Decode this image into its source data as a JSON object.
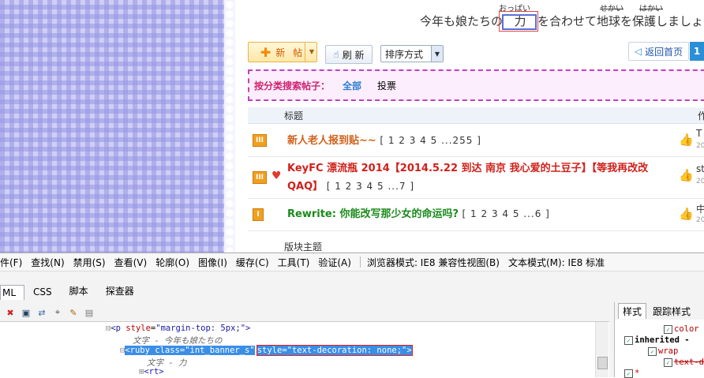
{
  "banner": {
    "text_before": "今年も娘たちの",
    "boxed": "力",
    "text_after": "を合わせて地球を保護しましょ",
    "ruby_chikara": "おっぱい",
    "ruby_chikyuu": "せかい",
    "ruby_hogo": "はかい"
  },
  "toolbar": {
    "new_post": "新 帖",
    "refresh": "刷 新",
    "sort": "排序方式",
    "back_home": "返回首页",
    "page": "1"
  },
  "filter": {
    "label": "按分类搜索帖子：",
    "selected": "全部",
    "other": "投票"
  },
  "table": {
    "col_title": "标题",
    "col_author": "作",
    "rows": [
      {
        "icon": "III",
        "title": "新人老人报到贴~~",
        "pages": "[ 1 2 3 4 5 ...255 ]",
        "author": "T",
        "year": "20",
        "color": "#d0601a"
      },
      {
        "icon": "III",
        "title": "KeyFC 漂流瓶 2014【2014.5.22 到达 南京 我心爱的土豆子】【等我再改改 QAQ】",
        "pages": "[ 1 2 3 4 5 ...7 ]",
        "author": "st",
        "year": "20",
        "color": "#d0201a"
      },
      {
        "icon": "I",
        "title": "Rewrite: 你能改写那少女的命运吗?",
        "pages": "[ 1 2 3 4 5 ...6 ]",
        "author": "中",
        "year": "20",
        "color": "#1a8a1a"
      }
    ],
    "section": "版块主题"
  },
  "devtools": {
    "menu": [
      "件(F)",
      "查找(N)",
      "禁用(S)",
      "查看(V)",
      "轮廓(O)",
      "图像(I)",
      "缓存(C)",
      "工具(T)",
      "验证(A)"
    ],
    "browser_mode": "浏览器模式: IE8 兼容性视图(B)",
    "doc_mode": "文本模式(M): IE8 标准",
    "tabs": [
      "ML",
      "CSS",
      "脚本",
      "探查器"
    ],
    "tree": {
      "line1_tag": "<p",
      "line1_attr": "style",
      "line1_val": "\"margin-top: 5px;\"",
      "line1_end": ">",
      "line2": "文字 - 今年も娘たちの",
      "line3_tag": "<ruby",
      "line3_attr": "class",
      "line3_val": "\"int_banner_s\"",
      "line3_hl": "style=\"text-decoration: none;\">",
      "line4": "文字 - 力",
      "line5": "<rt>"
    },
    "right_tabs": [
      "样式",
      "跟踪样式"
    ],
    "right_lines": {
      "color": "color",
      "inherited": "inherited -",
      "wrap": "wrap",
      "textdeco": "text-d",
      "star": "*"
    }
  }
}
